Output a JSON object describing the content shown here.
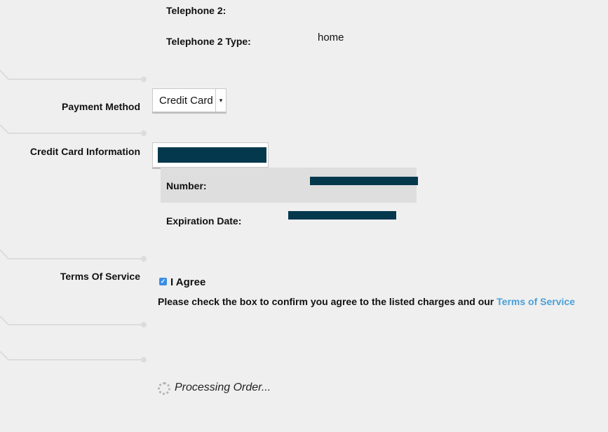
{
  "contact": {
    "telephone2_label": "Telephone 2:",
    "telephone2_type_label": "Telephone 2 Type:",
    "telephone2_type_value": "home"
  },
  "payment": {
    "label": "Payment Method",
    "selected": "Credit Card"
  },
  "credit_card": {
    "label": "Credit Card Information",
    "number_label": "Number:",
    "expiration_label": "Expiration Date:"
  },
  "terms": {
    "label": "Terms Of Service",
    "checkbox_label": "I Agree",
    "checked": true,
    "note_text": "Please check the box to confirm you agree to the listed charges and our ",
    "link_text": "Terms of Service"
  },
  "status": {
    "processing_text": "Processing Order..."
  },
  "colors": {
    "background": "#efefef",
    "redaction": "#04384d",
    "link": "#4a9fd8",
    "checkbox": "#3a8ee6"
  }
}
